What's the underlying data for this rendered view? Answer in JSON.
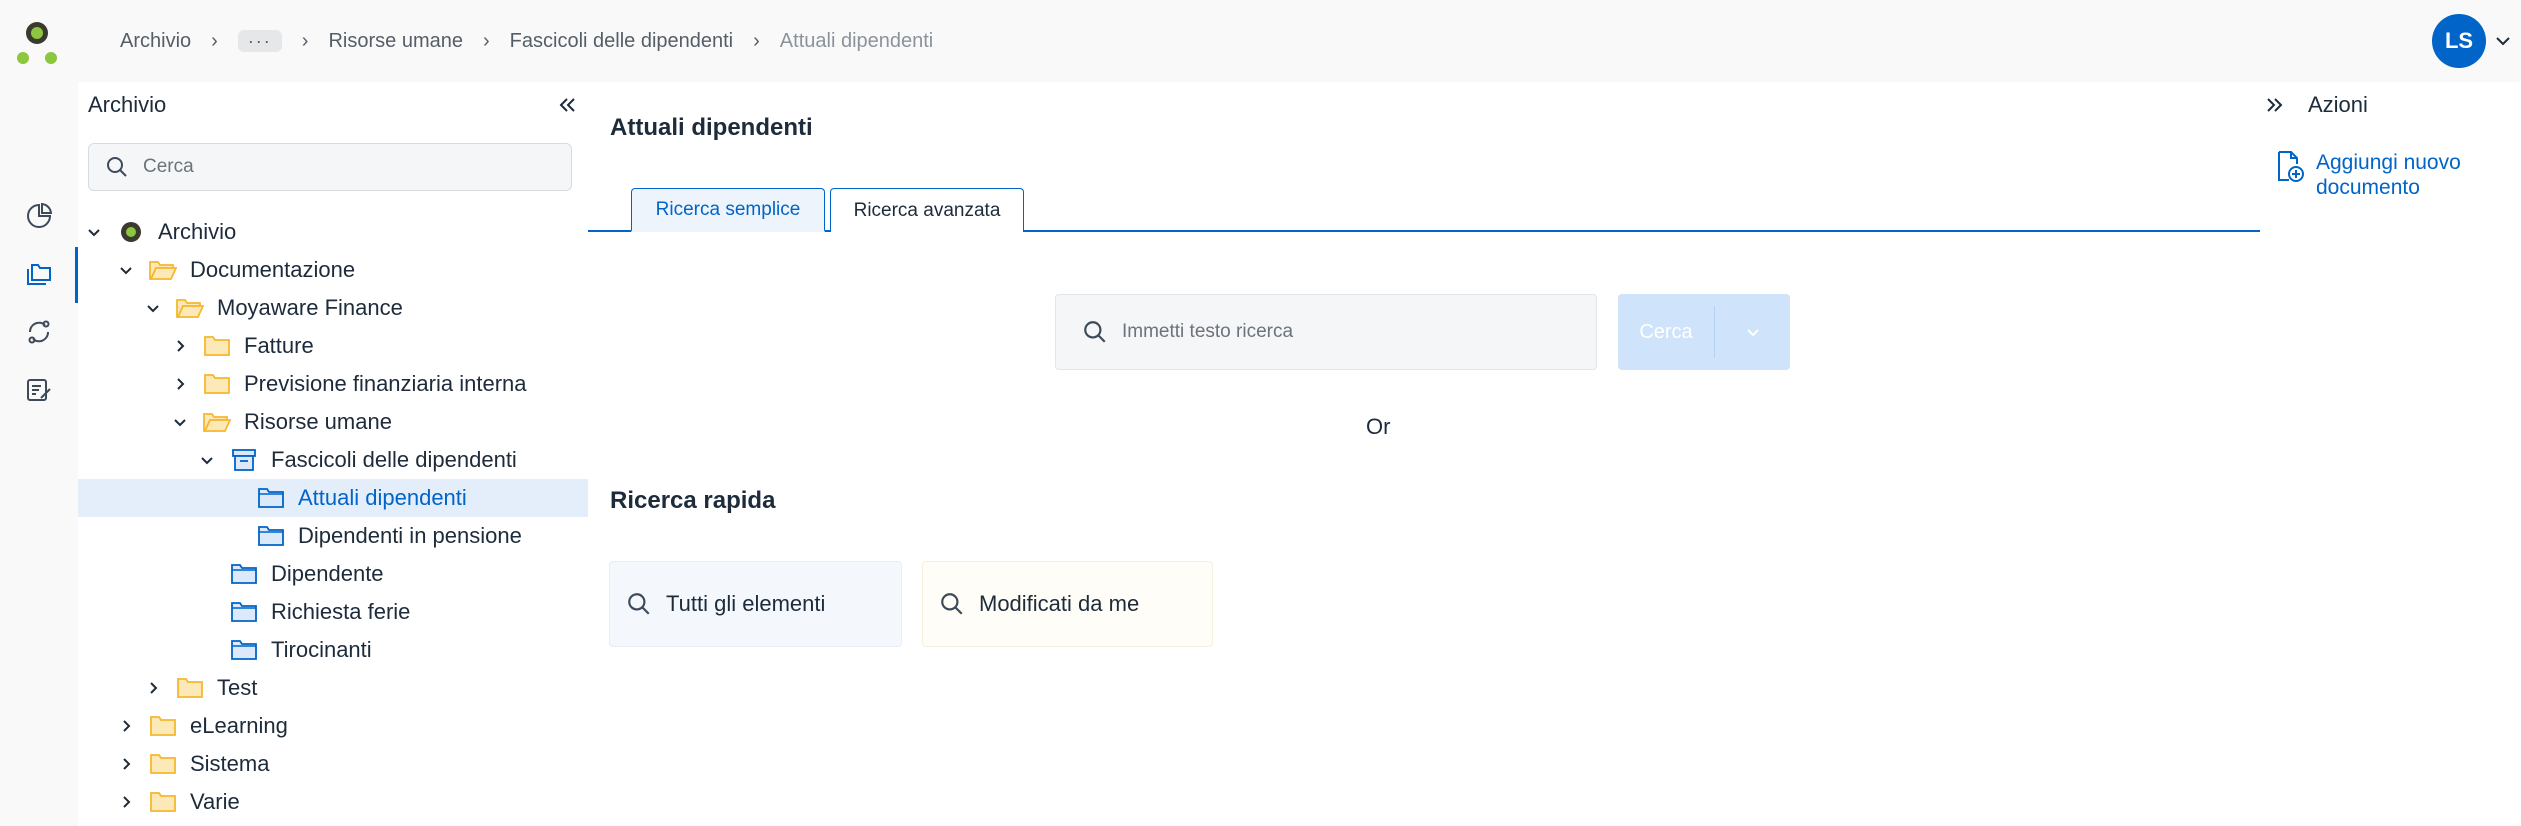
{
  "breadcrumb": {
    "items": [
      "Archivio",
      "···",
      "Risorse umane",
      "Fascicoli delle dipendenti",
      "Attuali dipendenti"
    ]
  },
  "user": {
    "initials": "LS"
  },
  "tree": {
    "title": "Archivio",
    "search_placeholder": "Cerca",
    "nodes": [
      {
        "label": "Archivio"
      },
      {
        "label": "Documentazione"
      },
      {
        "label": "Moyaware Finance"
      },
      {
        "label": "Fatture"
      },
      {
        "label": "Previsione finanziaria interna"
      },
      {
        "label": "Risorse umane"
      },
      {
        "label": "Fascicoli delle dipendenti"
      },
      {
        "label": "Attuali dipendenti"
      },
      {
        "label": "Dipendenti in pensione"
      },
      {
        "label": "Dipendente"
      },
      {
        "label": "Richiesta ferie"
      },
      {
        "label": "Tirocinanti"
      },
      {
        "label": "Test"
      },
      {
        "label": "eLearning"
      },
      {
        "label": "Sistema"
      },
      {
        "label": "Varie"
      }
    ]
  },
  "main": {
    "title": "Attuali dipendenti",
    "tabs": [
      {
        "label": "Ricerca semplice"
      },
      {
        "label": "Ricerca avanzata"
      }
    ],
    "search_placeholder": "Immetti testo ricerca",
    "search_button": "Cerca",
    "or_text": "Or",
    "quick_title": "Ricerca rapida",
    "quick": [
      {
        "label": "Tutti gli elementi"
      },
      {
        "label": "Modificati da me"
      }
    ]
  },
  "actions": {
    "title": "Azioni",
    "items": [
      {
        "label": "Aggiungi nuovo documento"
      }
    ]
  },
  "colors": {
    "accent": "#0064c8",
    "folder": "#f5b82e",
    "folder_blue": "#0064c8",
    "logo_green": "#8dc63f"
  }
}
